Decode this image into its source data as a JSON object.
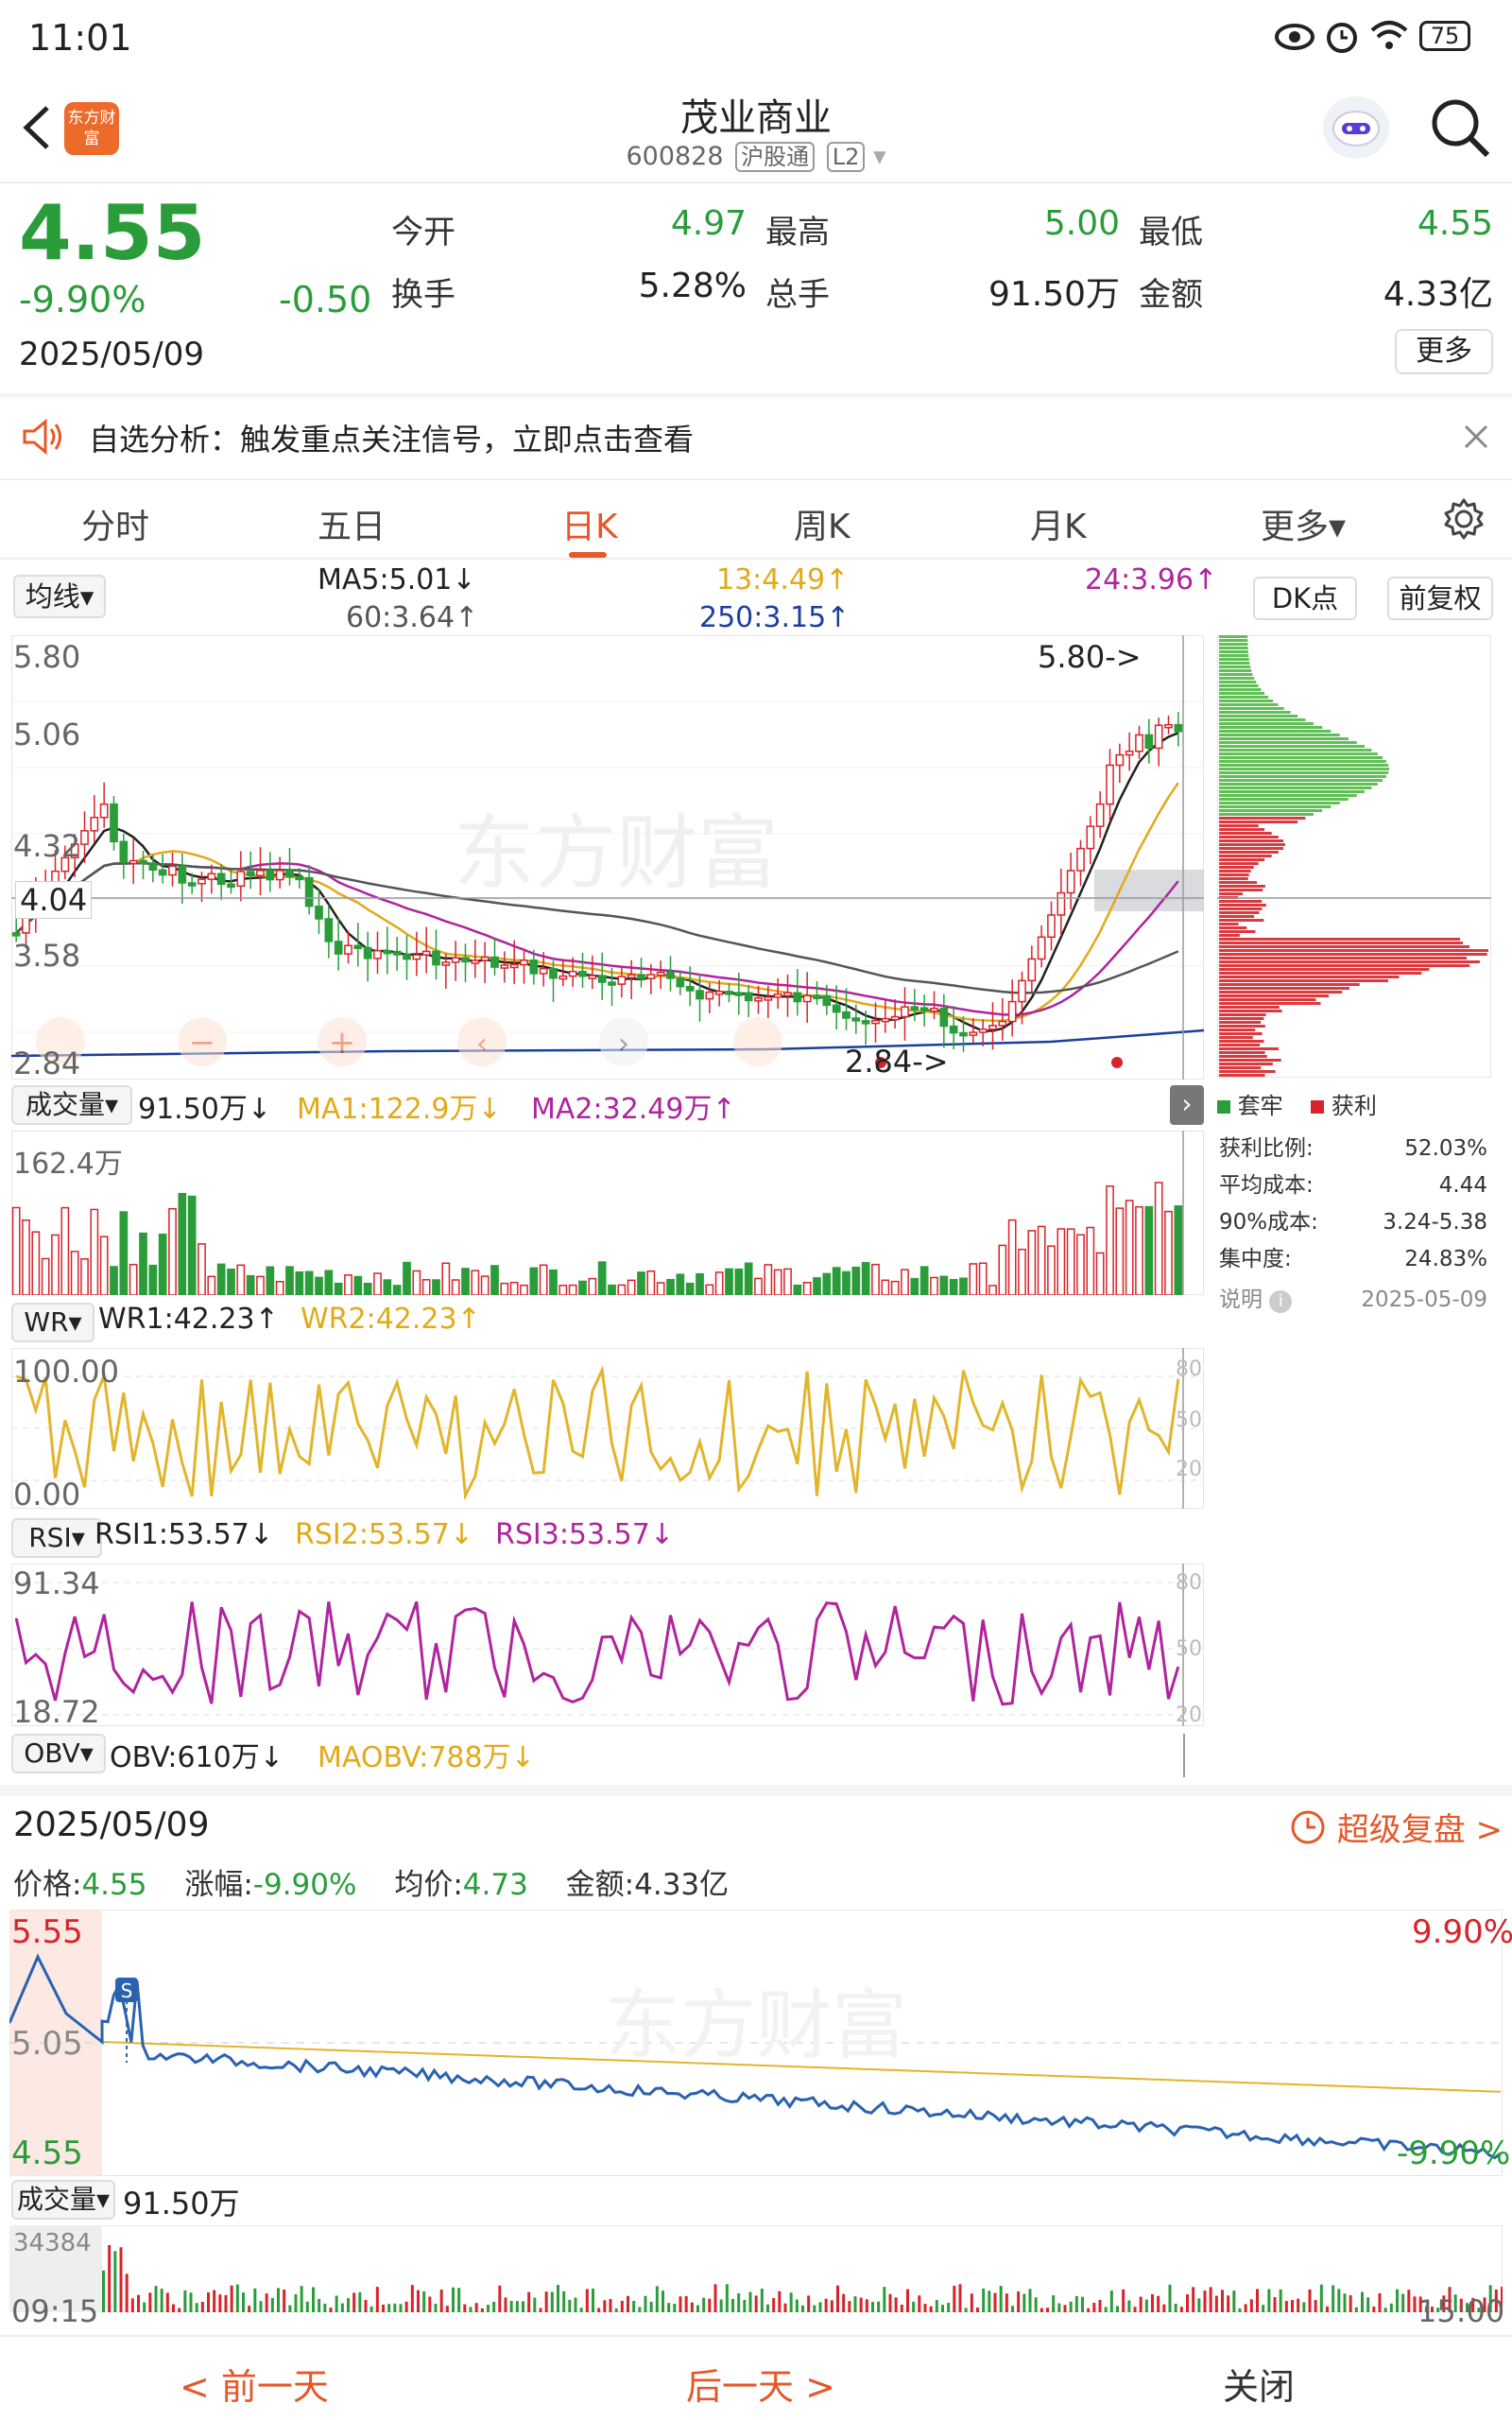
{
  "status": {
    "time": "11:01",
    "battery": "75"
  },
  "header": {
    "logo_text": "东方财富",
    "stock_name": "茂业商业",
    "stock_code": "600828",
    "market_tag": "沪股通",
    "level_tag": "L2"
  },
  "quote": {
    "price": "4.55",
    "pct": "-9.90%",
    "change": "-0.50",
    "date": "2025/05/09",
    "open_label": "今开",
    "open": "4.97",
    "high_label": "最高",
    "high": "5.00",
    "low_label": "最低",
    "low": "4.55",
    "turnover_label": "换手",
    "turnover": "5.28%",
    "volume_label": "总手",
    "volume": "91.50万",
    "amount_label": "金额",
    "amount": "4.33亿",
    "more": "更多"
  },
  "notice": {
    "text": "自选分析：触发重点关注信号，立即点击查看"
  },
  "tabs": [
    {
      "label": "分时"
    },
    {
      "label": "五日"
    },
    {
      "label": "日K"
    },
    {
      "label": "周K"
    },
    {
      "label": "月K"
    },
    {
      "label": "更多▾"
    }
  ],
  "kline": {
    "indicator_select": "均线▾",
    "ma5": "MA5:5.01↓",
    "ma13": "13:4.49↑",
    "ma24": "24:3.96↑",
    "ma60": "60:3.64↑",
    "ma250": "250:3.15↑",
    "dk_button": "DK点",
    "adj_button": "前复权",
    "y_labels": [
      "5.80",
      "5.06",
      "4.32",
      "3.58",
      "2.84"
    ],
    "cursor_price": "4.04",
    "max_marker": "5.80->",
    "min_marker": "2.84->",
    "watermark": "东方财富",
    "colors": {
      "up": "#d8232a",
      "down": "#2a9d3a",
      "ma5": "#222222",
      "ma13": "#e2a91a",
      "ma24": "#b0249e",
      "ma60": "#555555",
      "ma250": "#1c3f9e"
    }
  },
  "chip": {
    "legend_trapped": "套牢",
    "legend_profit": "获利",
    "rows": [
      {
        "label": "获利比例:",
        "value": "52.03%"
      },
      {
        "label": "平均成本:",
        "value": "4.44"
      },
      {
        "label": "90%成本:",
        "value": "3.24-5.38"
      },
      {
        "label": "集中度:",
        "value": "24.83%"
      }
    ],
    "note_label": "说明",
    "note_date": "2025-05-09"
  },
  "volume_panel": {
    "select": "成交量▾",
    "value": "91.50万↓",
    "ma1": "MA1:122.9万↓",
    "ma2": "MA2:32.49万↑",
    "y_max": "162.4万"
  },
  "wr_panel": {
    "select": "WR▾",
    "wr1": "WR1:42.23↑",
    "wr2": "WR2:42.23↑",
    "y_max": "100.00",
    "y_min": "0.00",
    "right_ticks": [
      "80",
      "50",
      "20"
    ]
  },
  "rsi_panel": {
    "select": "RSI▾",
    "rsi1": "RSI1:53.57↓",
    "rsi2": "RSI2:53.57↓",
    "rsi3": "RSI3:53.57↓",
    "y_max": "91.34",
    "y_min": "18.72",
    "right_ticks": [
      "80",
      "50",
      "20"
    ]
  },
  "obv_panel": {
    "select": "OBV▾",
    "obv": "OBV:610万↓",
    "maobv": "MAOBV:788万↓"
  },
  "intraday": {
    "date": "2025/05/09",
    "replay": "超级复盘 >",
    "price_label": "价格:",
    "price": "4.55",
    "pct_label": "涨幅:",
    "pct": "-9.90%",
    "avg_label": "均价:",
    "avg": "4.73",
    "amount_label": "金额:",
    "amount": "4.33亿",
    "y_top": "5.55",
    "y_mid": "5.05",
    "y_bot": "4.55",
    "pct_top": "9.90%",
    "pct_bot": "-9.90%",
    "s_marker": "S",
    "vol_select": "成交量▾",
    "vol_value": "91.50万",
    "vol_max": "34384",
    "time_start": "09:15",
    "time_end": "15:00",
    "watermark": "东方财富"
  },
  "footer": {
    "prev": "< 前一天",
    "next": "后一天 >",
    "close": "关闭"
  }
}
